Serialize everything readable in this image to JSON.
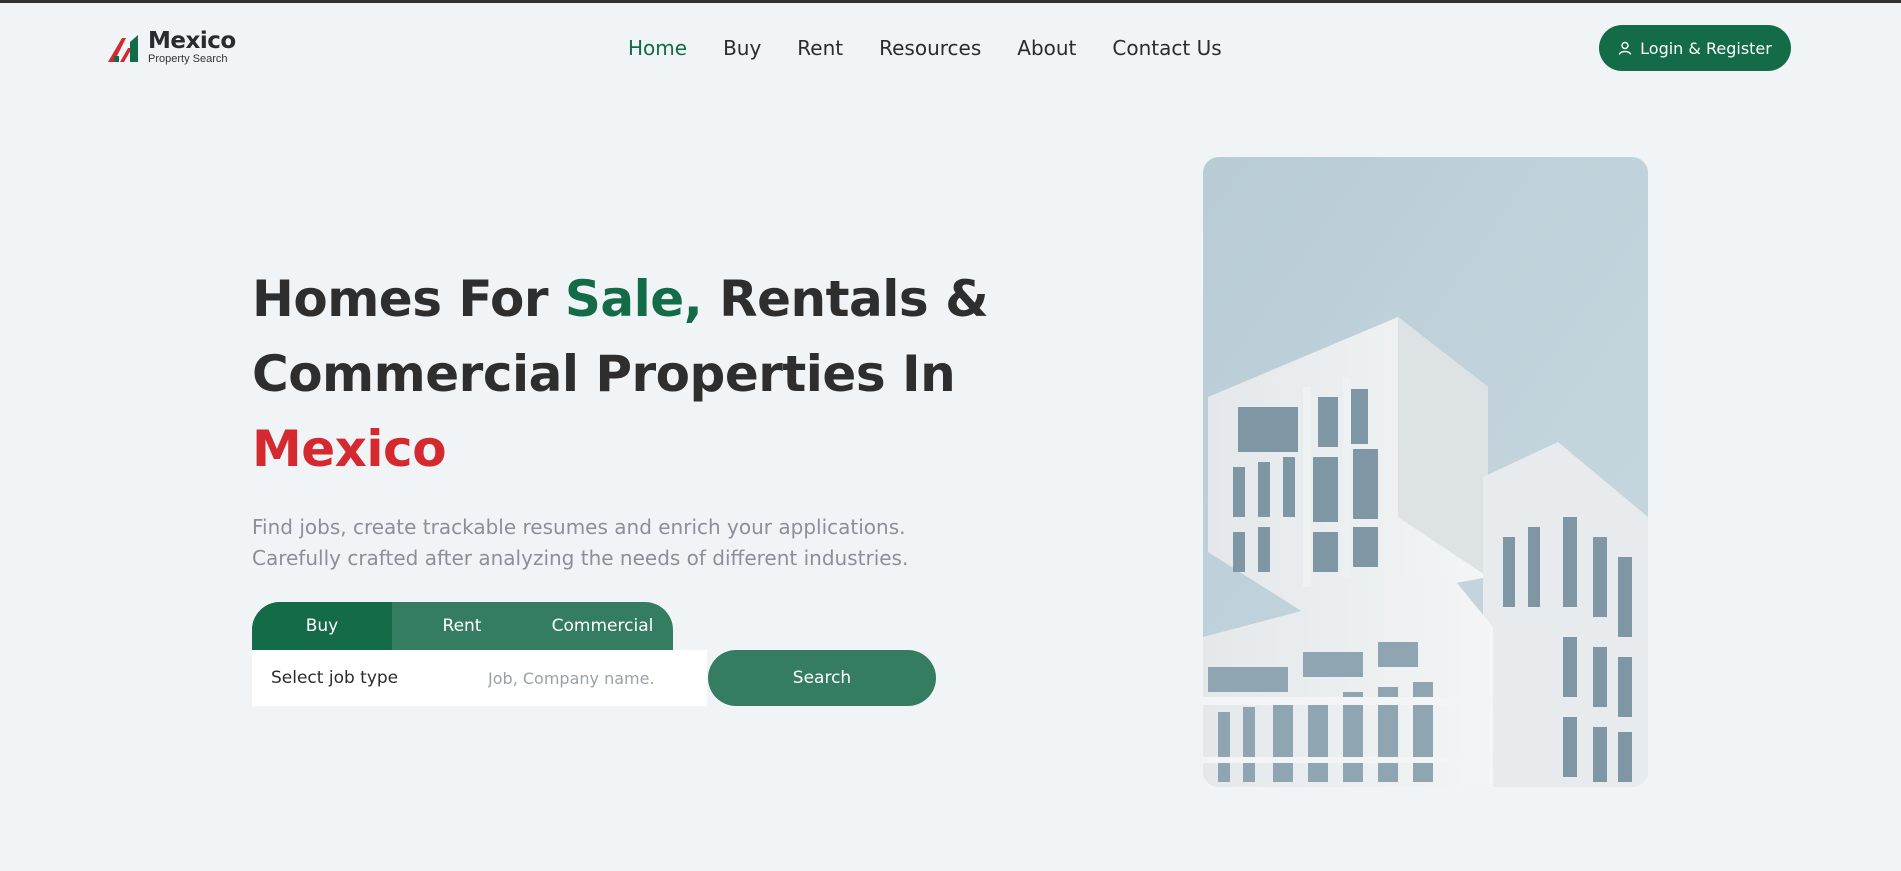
{
  "header": {
    "logo_title": "Mexico",
    "logo_subtitle": "Property Search",
    "nav": [
      {
        "label": "Home",
        "active": true
      },
      {
        "label": "Buy"
      },
      {
        "label": "Rent"
      },
      {
        "label": "Resources"
      },
      {
        "label": "About"
      },
      {
        "label": "Contact Us"
      }
    ],
    "login_label": "Login & Register"
  },
  "hero": {
    "title_part1": "Homes For ",
    "title_highlight_green": "Sale,",
    "title_part2": " Rentals & Commercial Properties In ",
    "title_highlight_red": "Mexico",
    "description_line1": "Find jobs, create trackable resumes and enrich your applications.",
    "description_line2": "Carefully crafted after analyzing the needs of different industries."
  },
  "search": {
    "tabs": [
      "Buy",
      "Rent",
      "Commercial"
    ],
    "active_tab": "Buy",
    "select_label": "Select job type",
    "input_placeholder": "Job, Company name.",
    "button_label": "Search"
  },
  "colors": {
    "brand_green": "#146b48",
    "accent_red": "#d42a2f",
    "background": "#f1f4f7"
  },
  "icons": {
    "logo": "house-roof-logo-icon",
    "login": "user-icon",
    "image": "modern-building-photo"
  }
}
